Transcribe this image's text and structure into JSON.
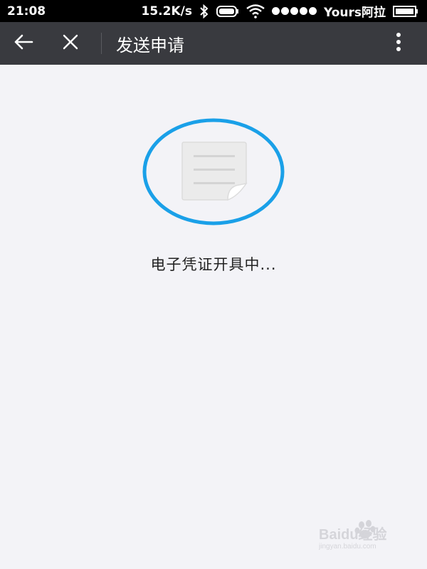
{
  "status_bar": {
    "time": "21:08",
    "network_speed": "15.2K/s",
    "carrier": "Yours阿拉",
    "icons": [
      "bluetooth-icon",
      "battery-icon",
      "wifi-icon",
      "signal-icon"
    ]
  },
  "nav_bar": {
    "title": "发送申请",
    "icons": [
      "back-arrow-icon",
      "close-icon",
      "more-vertical-icon"
    ]
  },
  "main": {
    "document_icon": "document-icon",
    "status_text": "电子凭证开具中...",
    "ring_color": "#1aa0e8"
  },
  "watermark": {
    "text": "Baidu经验",
    "sub_text": "jingyan.baidu.com"
  },
  "colors": {
    "nav_background": "#393a3f",
    "page_background": "#f3f3f7",
    "accent": "#1aa0e8"
  }
}
